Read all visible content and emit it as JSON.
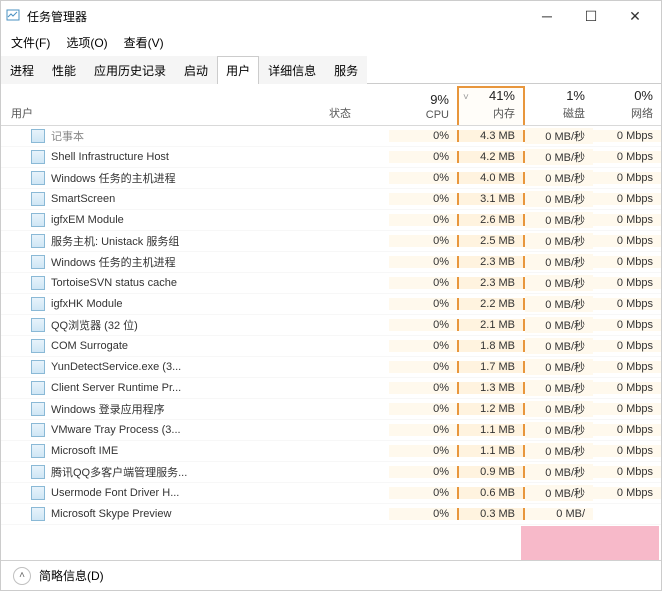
{
  "window": {
    "title": "任务管理器"
  },
  "menubar": [
    "文件(F)",
    "选项(O)",
    "查看(V)"
  ],
  "tabs": [
    "进程",
    "性能",
    "应用历史记录",
    "启动",
    "用户",
    "详细信息",
    "服务"
  ],
  "active_tab": 4,
  "columns": {
    "name": "用户",
    "status": "状态",
    "cpu": {
      "pct": "9%",
      "label": "CPU"
    },
    "memory": {
      "pct": "41%",
      "label": "内存"
    },
    "disk": {
      "pct": "1%",
      "label": "磁盘"
    },
    "network": {
      "pct": "0%",
      "label": "网络"
    }
  },
  "processes": [
    {
      "name": "记事本",
      "cpu": "0%",
      "mem": "4.3 MB",
      "disk": "0 MB/秒",
      "net": "0 Mbps",
      "partial": true
    },
    {
      "name": "Shell Infrastructure Host",
      "cpu": "0%",
      "mem": "4.2 MB",
      "disk": "0 MB/秒",
      "net": "0 Mbps"
    },
    {
      "name": "Windows 任务的主机进程",
      "cpu": "0%",
      "mem": "4.0 MB",
      "disk": "0 MB/秒",
      "net": "0 Mbps"
    },
    {
      "name": "SmartScreen",
      "cpu": "0%",
      "mem": "3.1 MB",
      "disk": "0 MB/秒",
      "net": "0 Mbps"
    },
    {
      "name": "igfxEM Module",
      "cpu": "0%",
      "mem": "2.6 MB",
      "disk": "0 MB/秒",
      "net": "0 Mbps"
    },
    {
      "name": "服务主机: Unistack 服务组",
      "cpu": "0%",
      "mem": "2.5 MB",
      "disk": "0 MB/秒",
      "net": "0 Mbps"
    },
    {
      "name": "Windows 任务的主机进程",
      "cpu": "0%",
      "mem": "2.3 MB",
      "disk": "0 MB/秒",
      "net": "0 Mbps"
    },
    {
      "name": "TortoiseSVN status cache",
      "cpu": "0%",
      "mem": "2.3 MB",
      "disk": "0 MB/秒",
      "net": "0 Mbps"
    },
    {
      "name": "igfxHK Module",
      "cpu": "0%",
      "mem": "2.2 MB",
      "disk": "0 MB/秒",
      "net": "0 Mbps"
    },
    {
      "name": "QQ浏览器 (32 位)",
      "cpu": "0%",
      "mem": "2.1 MB",
      "disk": "0 MB/秒",
      "net": "0 Mbps"
    },
    {
      "name": "COM Surrogate",
      "cpu": "0%",
      "mem": "1.8 MB",
      "disk": "0 MB/秒",
      "net": "0 Mbps"
    },
    {
      "name": "YunDetectService.exe (3...",
      "cpu": "0%",
      "mem": "1.7 MB",
      "disk": "0 MB/秒",
      "net": "0 Mbps"
    },
    {
      "name": "Client Server Runtime Pr...",
      "cpu": "0%",
      "mem": "1.3 MB",
      "disk": "0 MB/秒",
      "net": "0 Mbps"
    },
    {
      "name": "Windows 登录应用程序",
      "cpu": "0%",
      "mem": "1.2 MB",
      "disk": "0 MB/秒",
      "net": "0 Mbps"
    },
    {
      "name": "VMware Tray Process (3...",
      "cpu": "0%",
      "mem": "1.1 MB",
      "disk": "0 MB/秒",
      "net": "0 Mbps"
    },
    {
      "name": "Microsoft IME",
      "cpu": "0%",
      "mem": "1.1 MB",
      "disk": "0 MB/秒",
      "net": "0 Mbps"
    },
    {
      "name": "腾讯QQ多客户端管理服务...",
      "cpu": "0%",
      "mem": "0.9 MB",
      "disk": "0 MB/秒",
      "net": "0 Mbps"
    },
    {
      "name": "Usermode Font Driver H...",
      "cpu": "0%",
      "mem": "0.6 MB",
      "disk": "0 MB/秒",
      "net": "0 Mbps"
    },
    {
      "name": "Microsoft Skype Preview",
      "cpu": "0%",
      "mem": "0.3 MB",
      "disk": "0 MB/",
      "net": ""
    }
  ],
  "footer": {
    "label": "简略信息(D)"
  }
}
